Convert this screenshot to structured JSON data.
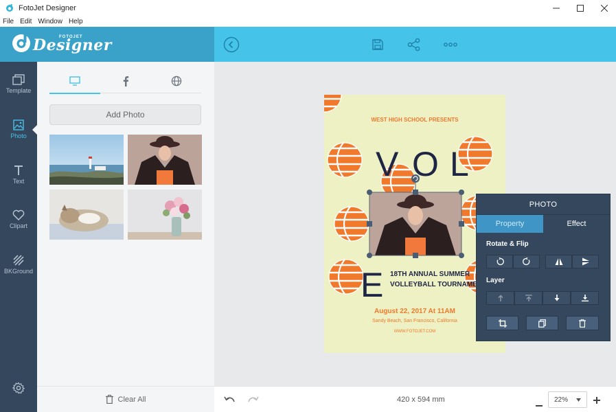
{
  "window": {
    "title": "FotoJet Designer",
    "controls": [
      "minimize",
      "maximize",
      "close"
    ]
  },
  "menu": [
    "File",
    "Edit",
    "Window",
    "Help"
  ],
  "brand": {
    "name": "Designer",
    "small": "FOTOJET",
    "color": "#3aa2c9"
  },
  "toolbar": {
    "accent": "#45c3e8",
    "icons": [
      "back-icon",
      "save-icon",
      "share-icon",
      "more-icon"
    ]
  },
  "sidebar": {
    "items": [
      {
        "label": "Template",
        "icon": "template-icon"
      },
      {
        "label": "Photo",
        "icon": "photo-icon"
      },
      {
        "label": "Text",
        "icon": "text-icon"
      },
      {
        "label": "Clipart",
        "icon": "heart-icon"
      },
      {
        "label": "BKGround",
        "icon": "background-icon"
      }
    ],
    "active": "Photo",
    "settings_icon": "gear-icon"
  },
  "photo_panel": {
    "tabs": [
      "computer-icon",
      "facebook-icon",
      "web-icon"
    ],
    "active_tab": "computer-icon",
    "add_photo_label": "Add Photo",
    "photos": [
      "lighthouse",
      "woman-with-hat",
      "sleeping-cat",
      "flowers-vase"
    ],
    "clear_all_label": "Clear All"
  },
  "poster": {
    "presents": "WEST HIGH SCHOOL PRESENTS",
    "letters": [
      "V",
      "O",
      "L",
      "E"
    ],
    "event_line1": "18TH ANNUAL SUMMER",
    "event_line2": "VOLLEYBALL TOURNAMENT",
    "date": "August 22, 2017 At 11AM",
    "location": "Sandy Beach, San Francisco, California",
    "website": "WWW.FOTOJET.COM",
    "bg_color": "#eef1c3",
    "accent_color": "#f0792c",
    "text_color": "#1f2544"
  },
  "status": {
    "canvas_size": "420 x 594 mm",
    "zoom": "22%"
  },
  "photo_popup": {
    "title": "PHOTO",
    "tabs": [
      "Property",
      "Effect"
    ],
    "active_tab": "Property",
    "rotate_label": "Rotate & Flip",
    "layer_label": "Layer",
    "rotate_buttons": [
      "rotate-left-icon",
      "rotate-right-icon",
      "flip-horizontal-icon",
      "flip-vertical-icon"
    ],
    "layer_buttons": [
      "bring-forward-icon",
      "bring-to-front-icon",
      "send-backward-icon",
      "send-to-back-icon"
    ],
    "action_buttons": [
      "crop-icon",
      "duplicate-icon",
      "delete-icon"
    ]
  }
}
